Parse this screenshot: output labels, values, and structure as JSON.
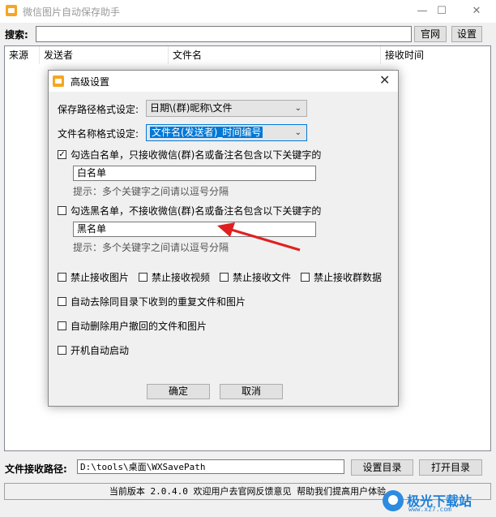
{
  "window": {
    "title": "微信图片自动保存助手",
    "minimize": "—",
    "maximize": "☐",
    "close": "✕"
  },
  "search": {
    "label": "搜索:",
    "value": "",
    "official_button": "官网",
    "settings_button": "设置"
  },
  "table": {
    "columns": [
      "来源",
      "发送者",
      "文件名",
      "接收时间"
    ]
  },
  "footer": {
    "path_label": "文件接收路径:",
    "path_value": "D:\\tools\\桌面\\WXSavePath",
    "set_dir_button": "设置目录",
    "open_dir_button": "打开目录",
    "status": "当前版本 2.0.4.0 欢迎用户去官网反馈意见 帮助我们提高用户体验"
  },
  "dialog": {
    "title": "高级设置",
    "close": "✕",
    "path_format_label": "保存路径格式设定:",
    "path_format_value": "日期\\(群)昵称\\文件",
    "name_format_label": "文件名称格式设定:",
    "name_format_value": "文件名(发送者)_时间编号",
    "whitelist_check_label": "勾选白名单，只接收微信(群)名或备注名包含以下关键字的",
    "whitelist_checked": true,
    "whitelist_value": "白名单",
    "whitelist_hint": "提示：多个关键字之间请以逗号分隔",
    "blacklist_check_label": "勾选黑名单，不接收微信(群)名或备注名包含以下关键字的",
    "blacklist_checked": false,
    "blacklist_value": "黑名单",
    "blacklist_hint": "提示：多个关键字之间请以逗号分隔",
    "options": {
      "no_images": "禁止接收图片",
      "no_videos": "禁止接收视频",
      "no_files": "禁止接收文件",
      "no_group": "禁止接收群数据",
      "dedupe": "自动去除同目录下收到的重复文件和图片",
      "auto_delete": "自动删除用户撤回的文件和图片",
      "autostart": "开机自动启动"
    },
    "ok_button": "确定",
    "cancel_button": "取消"
  },
  "watermark": {
    "text": "极光下载站",
    "url": "www.xz7.com"
  },
  "colors": {
    "accent": "#0078d7",
    "annotation_arrow": "#e02020",
    "app_icon": "#f5a623"
  }
}
